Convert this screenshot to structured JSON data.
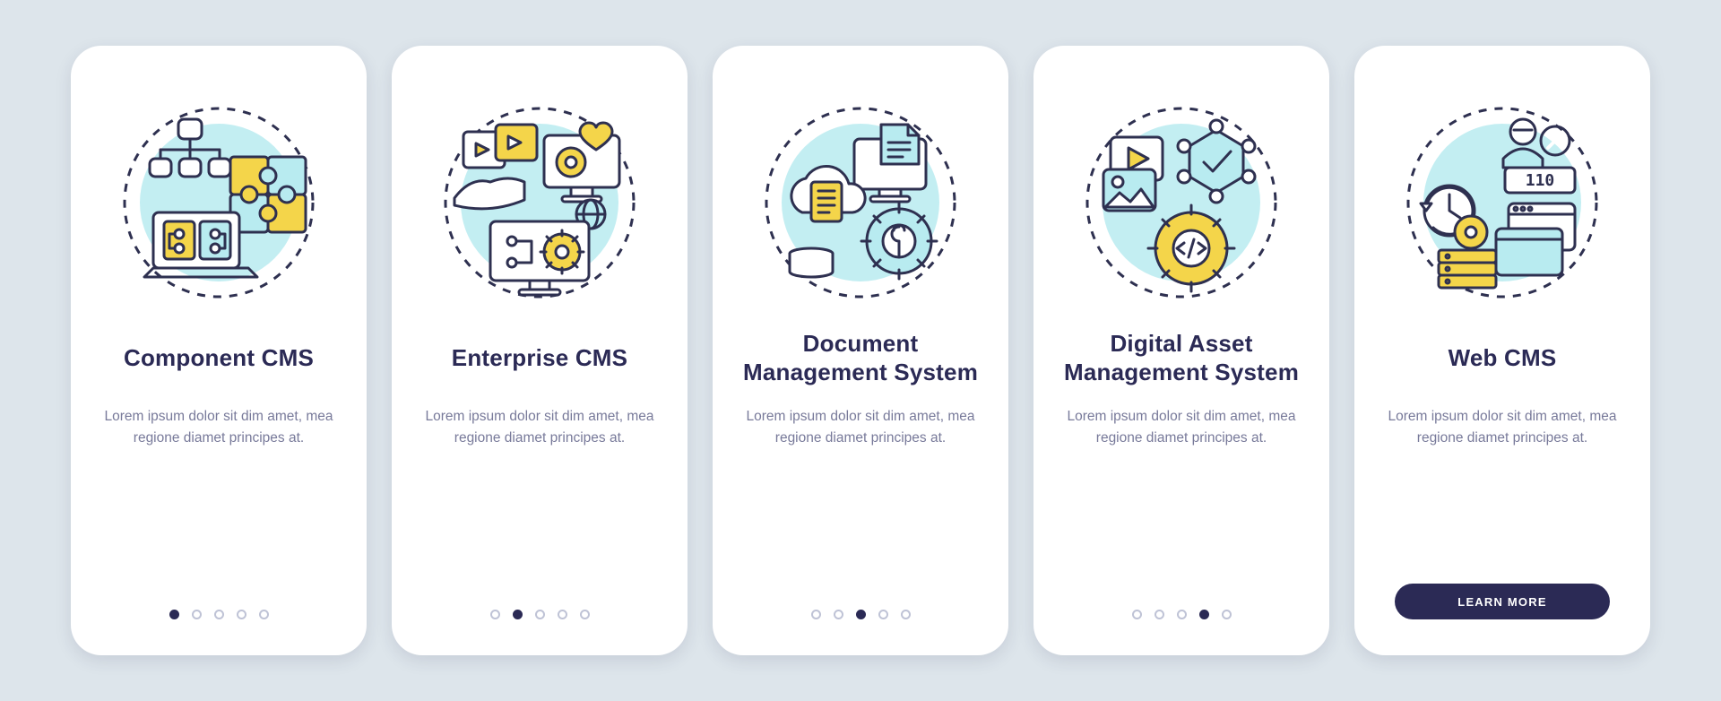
{
  "cards": [
    {
      "title": "Component CMS",
      "desc": "Lorem ipsum dolor sit dim amet, mea regione diamet principes at.",
      "icon": "component-cms-icon",
      "active_dot": 0
    },
    {
      "title": "Enterprise CMS",
      "desc": "Lorem ipsum dolor sit dim amet, mea regione diamet principes at.",
      "icon": "enterprise-cms-icon",
      "active_dot": 1
    },
    {
      "title": "Document Management System",
      "desc": "Lorem ipsum dolor sit dim amet, mea regione diamet principes at.",
      "icon": "document-management-icon",
      "active_dot": 2
    },
    {
      "title": "Digital Asset Management System",
      "desc": "Lorem ipsum dolor sit dim amet, mea regione diamet principes at.",
      "icon": "digital-asset-icon",
      "active_dot": 3
    },
    {
      "title": "Web CMS",
      "desc": "Lorem ipsum dolor sit dim amet, mea regione diamet principes at.",
      "icon": "web-cms-icon",
      "cta": "LEARN MORE"
    }
  ],
  "dot_count": 5,
  "colors": {
    "background": "#dde5eb",
    "card": "#ffffff",
    "ink": "#2b2a55",
    "muted": "#787a9a",
    "yellow": "#f4d54a",
    "cyan": "#b8ebf0"
  }
}
